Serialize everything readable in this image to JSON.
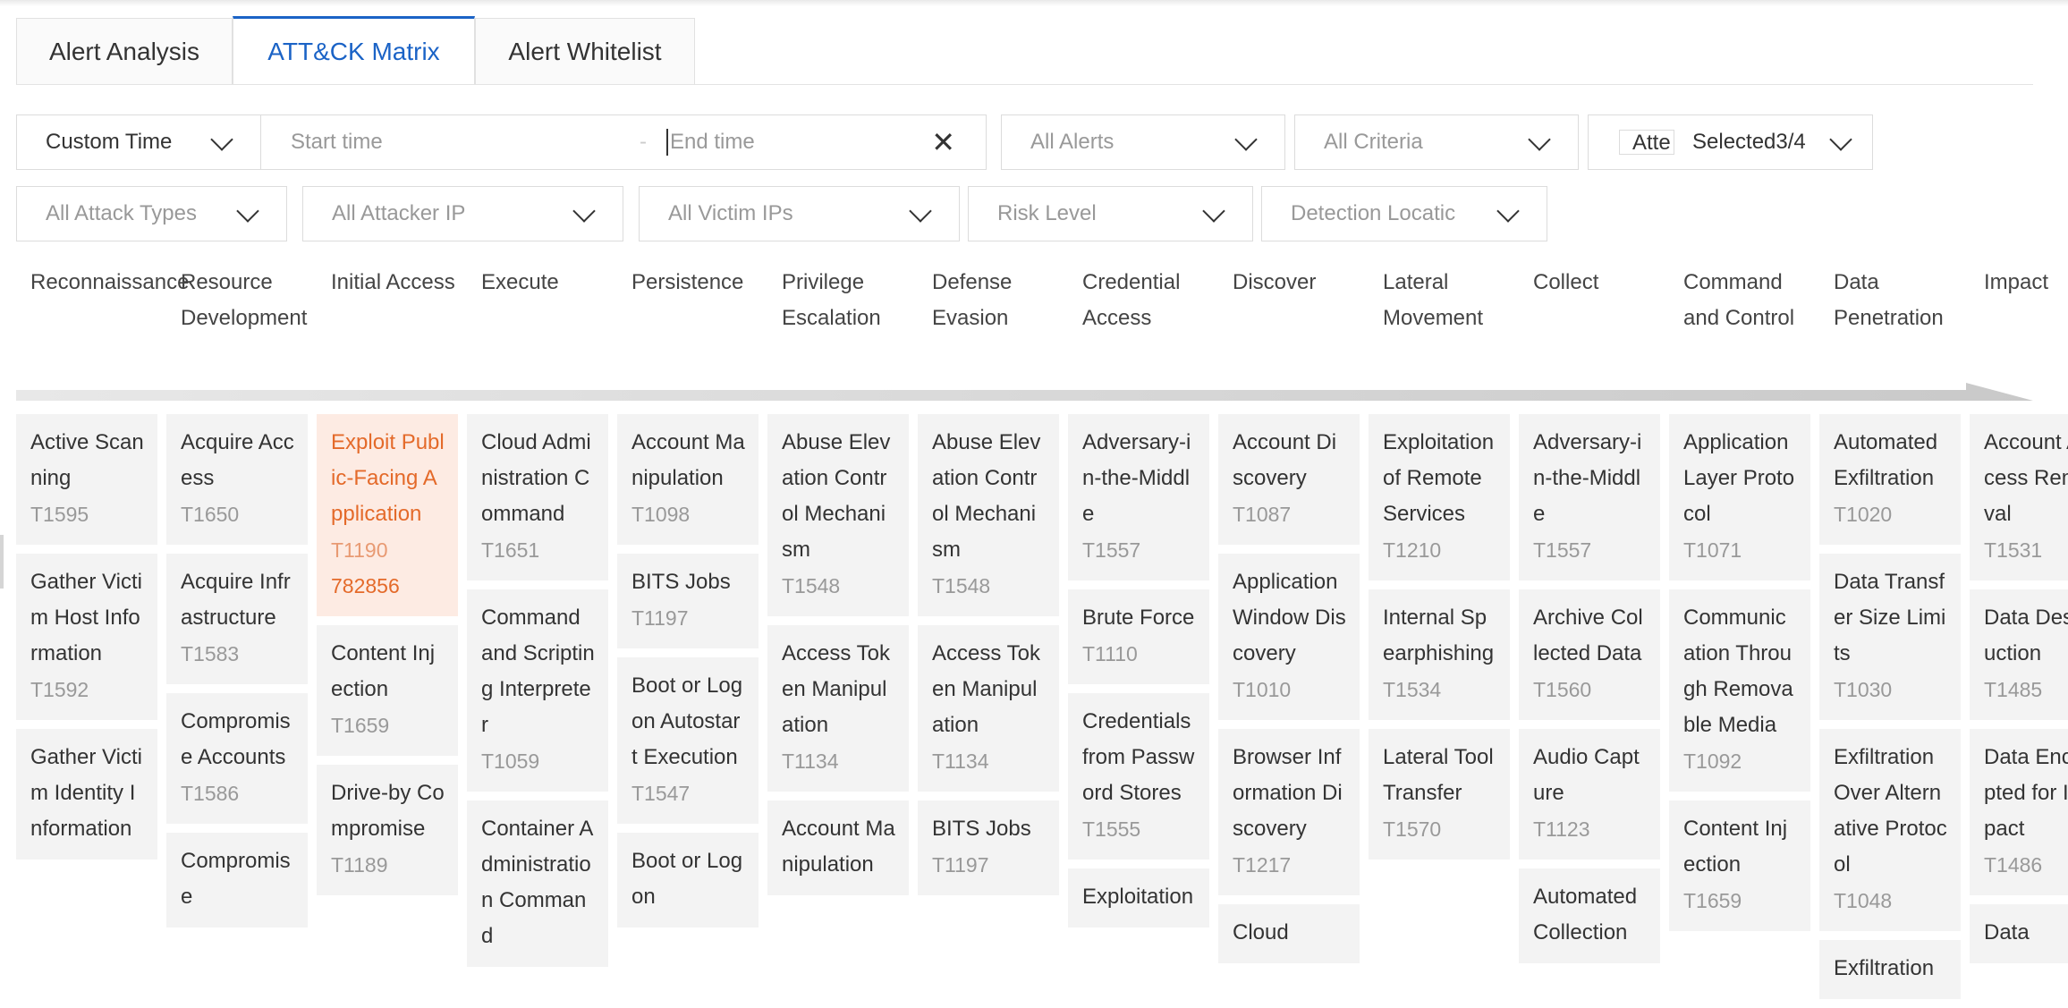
{
  "tabs": [
    "Alert Analysis",
    "ATT&CK Matrix",
    "Alert Whitelist"
  ],
  "filters": {
    "time_range": "Custom Time",
    "start_placeholder": "Start time",
    "end_placeholder": "End time",
    "alerts": "All Alerts",
    "criteria": "All Criteria",
    "attack_chip": "Atte",
    "selected": "Selected3/4",
    "attack_types": "All Attack Types",
    "attacker_ip": "All Attacker IP",
    "victim_ips": "All Victim IPs",
    "risk_level": "Risk Level",
    "detection_location": "Detection Locatic"
  },
  "columns": [
    {
      "header": "Reconnaissance",
      "cells": [
        {
          "name": "Active Scanning",
          "id": "T1595"
        },
        {
          "name": "Gather Victim Host Information",
          "id": "T1592"
        },
        {
          "name": "Gather Victim Identity Information",
          "id": ""
        }
      ]
    },
    {
      "header": "Resource Development",
      "cells": [
        {
          "name": "Acquire Access",
          "id": "T1650"
        },
        {
          "name": "Acquire Infrastructure",
          "id": "T1583"
        },
        {
          "name": "Compromise Accounts",
          "id": "T1586"
        },
        {
          "name": "Compromise",
          "id": ""
        }
      ]
    },
    {
      "header": "Initial Access",
      "cells": [
        {
          "name": "Exploit Public-Facing Application",
          "id": "T1190",
          "count": "782856"
        },
        {
          "name": "Content Injection",
          "id": "T1659"
        },
        {
          "name": "Drive-by Compromise",
          "id": "T1189"
        }
      ]
    },
    {
      "header": "Execute",
      "cells": [
        {
          "name": "Cloud Administration Command",
          "id": "T1651"
        },
        {
          "name": "Command and Scripting Interpreter",
          "id": "T1059"
        },
        {
          "name": "Container Administration Command",
          "id": ""
        }
      ]
    },
    {
      "header": "Persistence",
      "cells": [
        {
          "name": "Account Manipulation",
          "id": "T1098"
        },
        {
          "name": "BITS Jobs",
          "id": "T1197"
        },
        {
          "name": "Boot or Logon Autostart Execution",
          "id": "T1547"
        },
        {
          "name": "Boot or Logon",
          "id": ""
        }
      ]
    },
    {
      "header": "Privilege Escalation",
      "cells": [
        {
          "name": "Abuse Elevation Control Mechanism",
          "id": "T1548"
        },
        {
          "name": "Access Token Manipulation",
          "id": "T1134"
        },
        {
          "name": "Account Manipulation",
          "id": ""
        }
      ]
    },
    {
      "header": "Defense Evasion",
      "cells": [
        {
          "name": "Abuse Elevation Control Mechanism",
          "id": "T1548"
        },
        {
          "name": "Access Token Manipulation",
          "id": "T1134"
        },
        {
          "name": "BITS Jobs",
          "id": "T1197"
        }
      ]
    },
    {
      "header": "Credential Access",
      "cells": [
        {
          "name": "Adversary-in-the-Middle",
          "id": "T1557"
        },
        {
          "name": "Brute Force",
          "id": "T1110"
        },
        {
          "name": "Credentials from Password Stores",
          "id": "T1555"
        },
        {
          "name": "Exploitation",
          "id": ""
        }
      ]
    },
    {
      "header": "Discover",
      "cells": [
        {
          "name": "Account Discovery",
          "id": "T1087"
        },
        {
          "name": "Application Window Discovery",
          "id": "T1010"
        },
        {
          "name": "Browser Information Discovery",
          "id": "T1217"
        },
        {
          "name": "Cloud",
          "id": ""
        }
      ]
    },
    {
      "header": "Lateral Movement",
      "cells": [
        {
          "name": "Exploitation of Remote Services",
          "id": "T1210"
        },
        {
          "name": "Internal Spearphishing",
          "id": "T1534"
        },
        {
          "name": "Lateral Tool Transfer",
          "id": "T1570"
        }
      ]
    },
    {
      "header": "Collect",
      "cells": [
        {
          "name": "Adversary-in-the-Middle",
          "id": "T1557"
        },
        {
          "name": "Archive Collected Data",
          "id": "T1560"
        },
        {
          "name": "Audio Capture",
          "id": "T1123"
        },
        {
          "name": "Automated Collection",
          "id": ""
        }
      ]
    },
    {
      "header": "Command and Control",
      "cells": [
        {
          "name": "Application Layer Protocol",
          "id": "T1071"
        },
        {
          "name": "Communication Through Removable Media",
          "id": "T1092"
        },
        {
          "name": "Content Injection",
          "id": "T1659"
        }
      ]
    },
    {
      "header": "Data Penetration",
      "cells": [
        {
          "name": "Automated Exfiltration",
          "id": "T1020"
        },
        {
          "name": "Data Transfer Size Limits",
          "id": "T1030"
        },
        {
          "name": "Exfiltration Over Alternative Protocol",
          "id": "T1048"
        },
        {
          "name": "Exfiltration",
          "id": ""
        }
      ]
    },
    {
      "header": "Impact",
      "cells": [
        {
          "name": "Account Access Removal",
          "id": "T1531"
        },
        {
          "name": "Data Destruction",
          "id": "T1485"
        },
        {
          "name": "Data Encrypted for Impact",
          "id": "T1486"
        },
        {
          "name": "Data",
          "id": ""
        }
      ]
    }
  ],
  "colors": {
    "accent": "#1b63c6",
    "highlight_bg": "#fdebe3",
    "highlight_text": "#e46a2a",
    "cell_bg": "#f3f3f3"
  }
}
